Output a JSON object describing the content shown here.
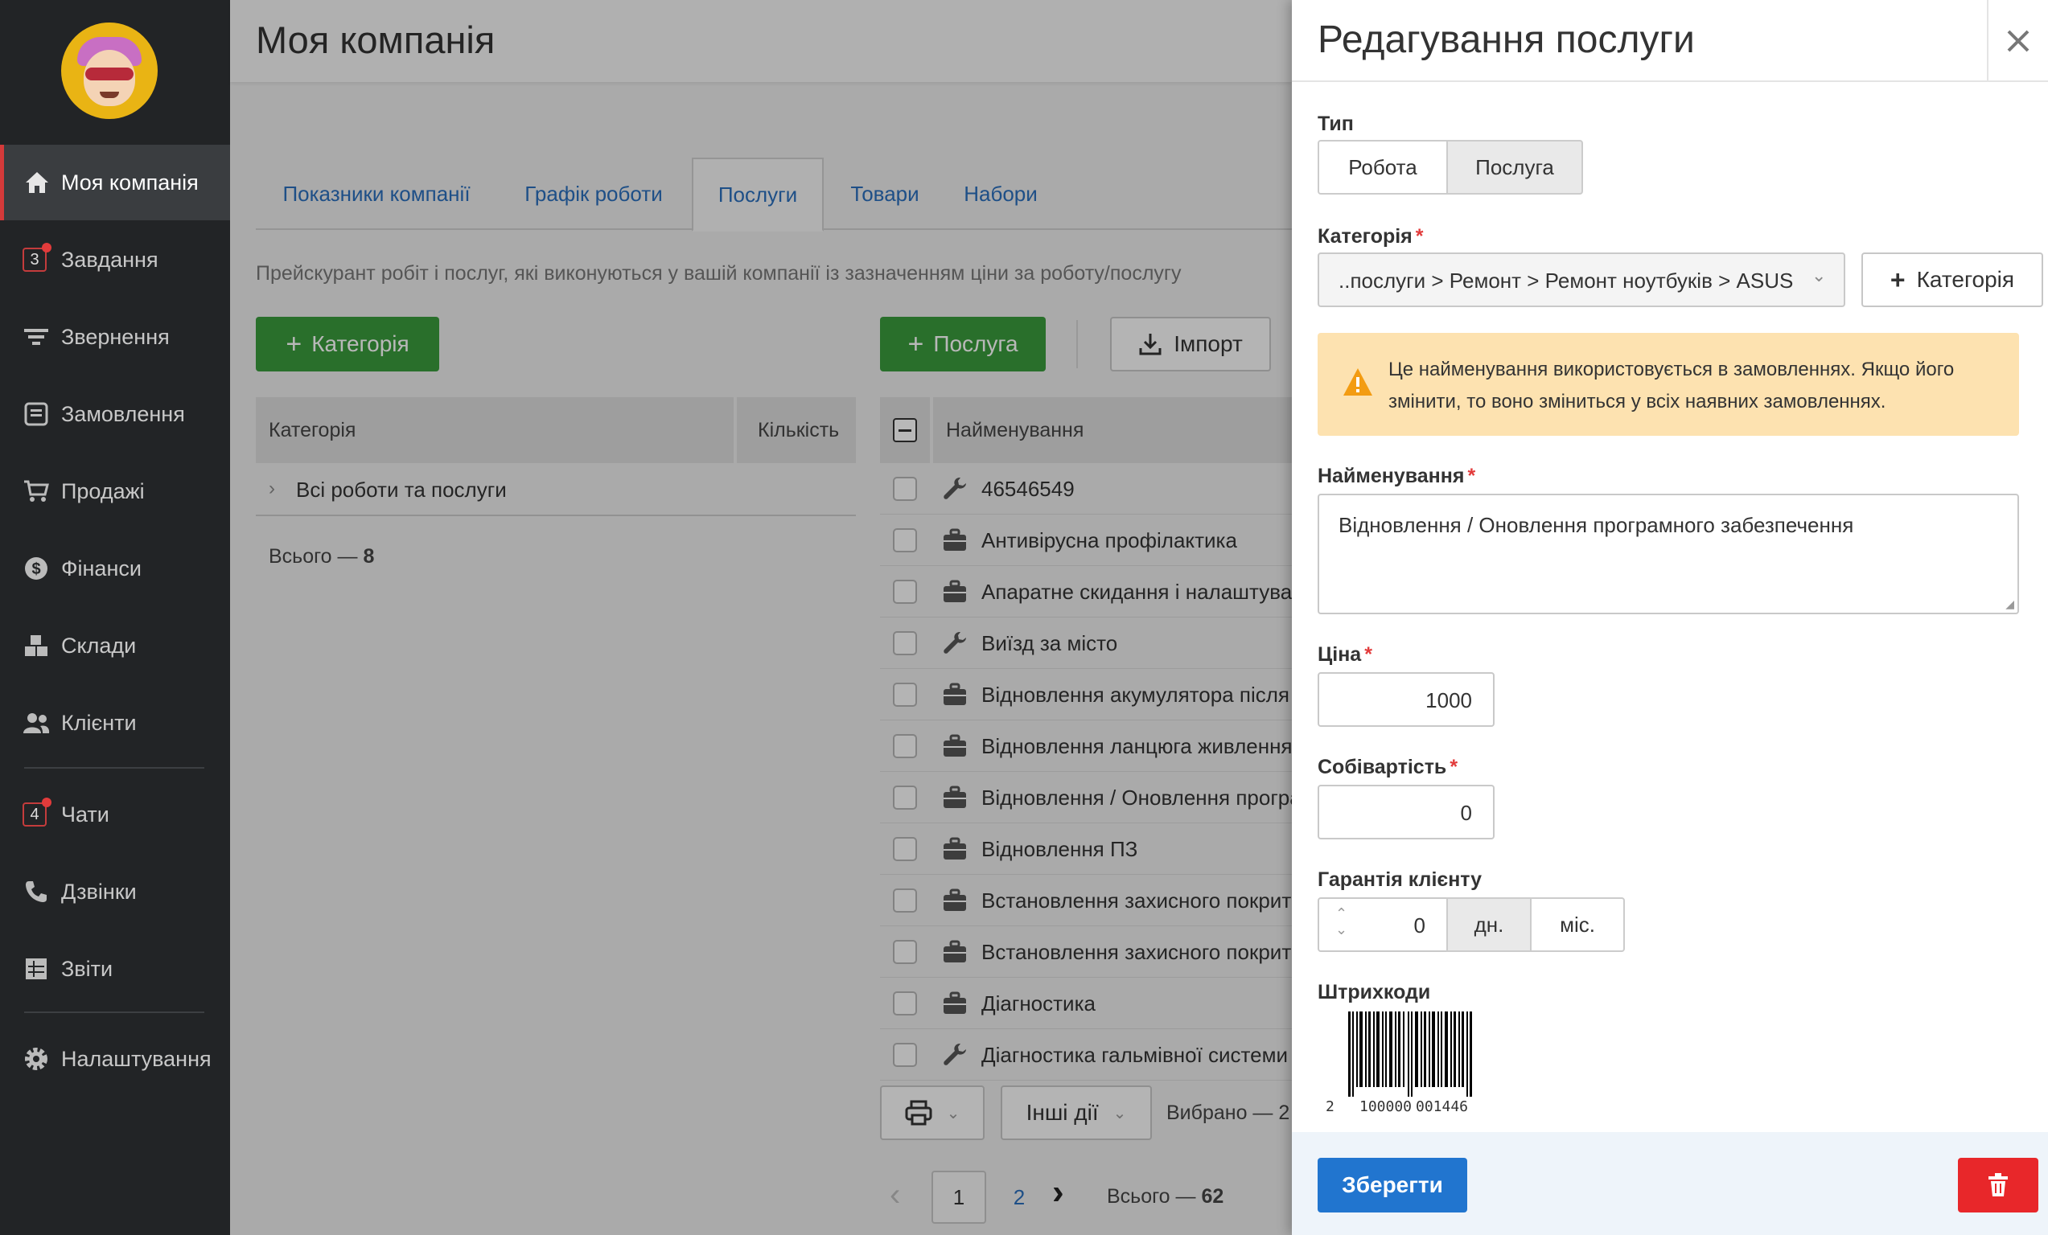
{
  "sidebar": {
    "items": [
      {
        "label": "Моя компанія",
        "icon": "home-icon"
      },
      {
        "label": "Завдання",
        "icon": "tasks-icon",
        "badge": "3"
      },
      {
        "label": "Звернення",
        "icon": "filter-icon"
      },
      {
        "label": "Замовлення",
        "icon": "order-icon"
      },
      {
        "label": "Продажі",
        "icon": "cart-icon"
      },
      {
        "label": "Фінанси",
        "icon": "dollar-icon"
      },
      {
        "label": "Склади",
        "icon": "boxes-icon"
      },
      {
        "label": "Клієнти",
        "icon": "users-icon"
      },
      {
        "label": "Чати",
        "icon": "chat-icon",
        "badge": "4"
      },
      {
        "label": "Дзвінки",
        "icon": "phone-icon"
      },
      {
        "label": "Звіти",
        "icon": "reports-icon"
      },
      {
        "label": "Налаштування",
        "icon": "gear-icon"
      }
    ]
  },
  "main": {
    "title": "Моя компанія",
    "tabs": [
      "Показники компанії",
      "Графік роботи",
      "Послуги",
      "Товари",
      "Набори"
    ],
    "active_tab": "Послуги",
    "subtitle": "Прейскурант робіт і послуг, які виконуються у вашій компанії із зазначенням ціни за роботу/послугу",
    "add_category_label": "Категорія",
    "add_service_label": "Послуга",
    "import_label": "Імпорт",
    "categories": {
      "header_category": "Категорія",
      "header_count": "Кількість",
      "row": "Всі роботи та послуги",
      "total_prefix": "Всього — ",
      "total_value": "8"
    },
    "services": {
      "header_name": "Найменування",
      "rows": [
        {
          "name": "46546549",
          "icon": "wrench-icon"
        },
        {
          "name": "Антивірусна профілактика",
          "icon": "briefcase-icon"
        },
        {
          "name": "Апаратне скидання і налаштуван",
          "icon": "briefcase-icon"
        },
        {
          "name": "Виїзд за місто",
          "icon": "wrench-icon"
        },
        {
          "name": "Відновлення акумулятора після п",
          "icon": "briefcase-icon"
        },
        {
          "name": "Відновлення ланцюга живлення",
          "icon": "briefcase-icon"
        },
        {
          "name": "Відновлення / Оновлення програ",
          "icon": "briefcase-icon"
        },
        {
          "name": "Відновлення ПЗ",
          "icon": "briefcase-icon"
        },
        {
          "name": "Встановлення захисного покрит",
          "icon": "briefcase-icon"
        },
        {
          "name": "Встановлення захисного покрит",
          "icon": "briefcase-icon"
        },
        {
          "name": "Діагностика",
          "icon": "briefcase-icon"
        },
        {
          "name": "Діагностика гальмівної системи",
          "icon": "wrench-icon"
        }
      ],
      "other_actions_label": "Інші дії",
      "selected_prefix": "Вибрано — 2",
      "pagination": {
        "pages": [
          "1",
          "2"
        ],
        "current": "1",
        "total_prefix": "Всього — ",
        "total_value": "62"
      }
    }
  },
  "panel": {
    "title": "Редагування послуги",
    "type_label": "Тип",
    "type_options": [
      "Робота",
      "Послуга"
    ],
    "type_selected": "Послуга",
    "category_label": "Категорія",
    "category_value": "..послуги > Ремонт > Ремонт ноутбуків > ASUS",
    "add_category_label": "Категорія",
    "warning_text": "Це найменування використовується в замовленнях. Якщо його змінити, то воно зміниться у всіх наявних замовленнях.",
    "name_label": "Найменування",
    "name_value": "Відновлення / Оновлення програмного забезпечення",
    "price_label": "Ціна",
    "price_value": "1000",
    "cost_label": "Собівартість",
    "cost_value": "0",
    "warranty_label": "Гарантія клієнту",
    "warranty_value": "0",
    "warranty_units": [
      "дн.",
      "міс."
    ],
    "warranty_unit_selected": "дн.",
    "barcodes_label": "Штрихкоди",
    "barcode_digits": [
      "2",
      "100000",
      "001446"
    ],
    "save_label": "Зберегти"
  },
  "colors": {
    "sidebar_bg": "#222426",
    "accent_green": "#3a9a3c",
    "accent_blue": "#2175cf",
    "danger_red": "#e8272a",
    "warning_bg": "#fde2b0",
    "link_blue": "#2a6ebb"
  }
}
